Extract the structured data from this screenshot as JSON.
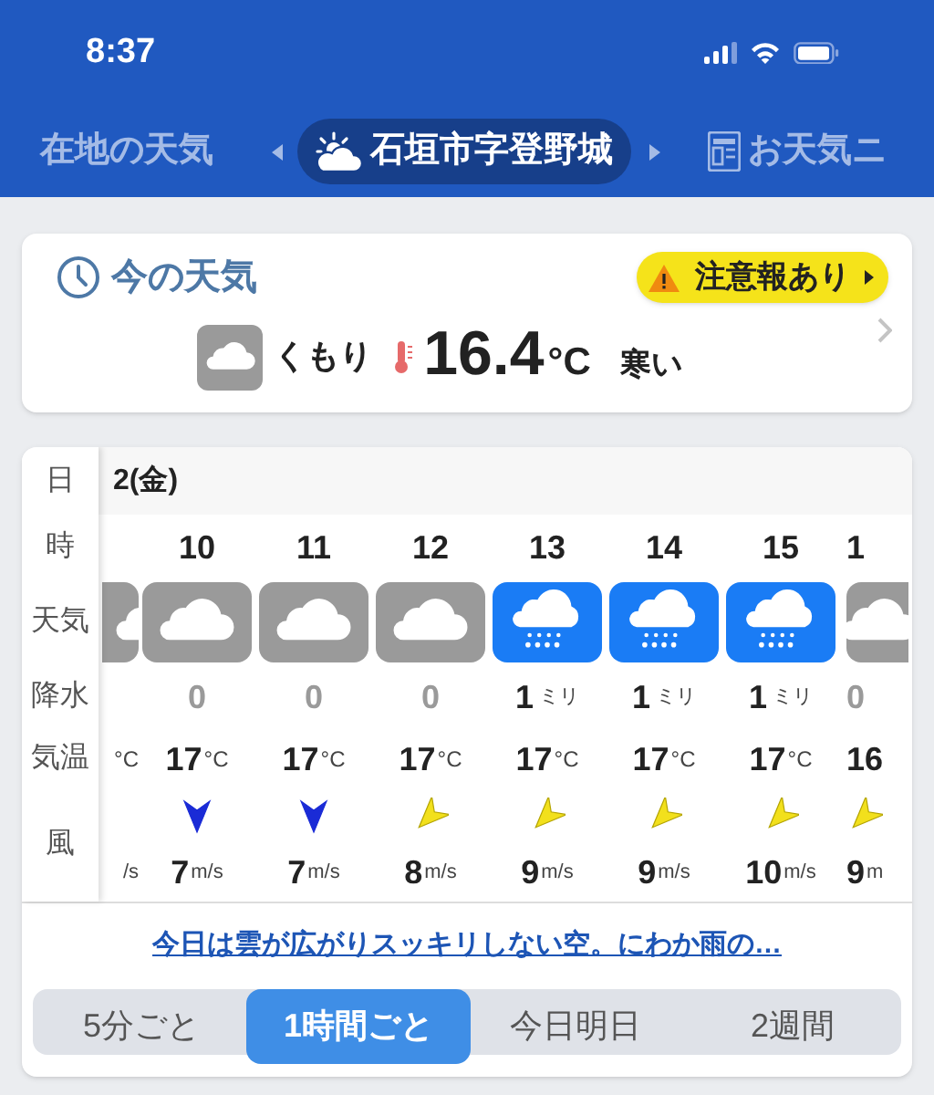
{
  "status_bar": {
    "time": "8:37"
  },
  "location_tabs": [
    {
      "label": "在地の天気",
      "selected": false,
      "kind": "text"
    },
    {
      "label": "石垣市字登野城",
      "selected": true,
      "kind": "location"
    },
    {
      "label": "お天気ニ",
      "selected": false,
      "kind": "news"
    }
  ],
  "current": {
    "title": "今の天気",
    "alert": "注意報あり",
    "icon": {
      "kind": "cloudy"
    },
    "condition": "くもり",
    "temperature": "16.4",
    "unit": "°C",
    "feel": "寒い"
  },
  "forecast": {
    "labels": [
      "日",
      "時",
      "天気",
      "降水",
      "気温",
      "風"
    ],
    "date": "2(金)",
    "hours": [
      {
        "kind": "partial_left",
        "icon": {
          "kind": "cloudy"
        },
        "temp_unit": "°C",
        "wind_unit": "/s"
      },
      {
        "kind": "full",
        "hour": "10",
        "icon": {
          "kind": "cloudy"
        },
        "precip": "0",
        "temp": "17",
        "temp_unit": "°C",
        "wind_arrow": {
          "kind": "north",
          "color": "#1a2bd6"
        },
        "wind": "7",
        "wind_unit": "m/s"
      },
      {
        "kind": "full",
        "hour": "11",
        "icon": {
          "kind": "cloudy"
        },
        "precip": "0",
        "temp": "17",
        "temp_unit": "°C",
        "wind_arrow": {
          "kind": "north",
          "color": "#1a2bd6"
        },
        "wind": "7",
        "wind_unit": "m/s"
      },
      {
        "kind": "full",
        "hour": "12",
        "icon": {
          "kind": "cloudy"
        },
        "precip": "0",
        "temp": "17",
        "temp_unit": "°C",
        "wind_arrow": {
          "kind": "northeast",
          "color": "#f2e01c"
        },
        "wind": "8",
        "wind_unit": "m/s"
      },
      {
        "kind": "full",
        "hour": "13",
        "icon": {
          "kind": "rain"
        },
        "precip": "1",
        "precip_unit": "ミリ",
        "temp": "17",
        "temp_unit": "°C",
        "wind_arrow": {
          "kind": "northeast",
          "color": "#f2e01c"
        },
        "wind": "9",
        "wind_unit": "m/s"
      },
      {
        "kind": "full",
        "hour": "14",
        "icon": {
          "kind": "rain"
        },
        "precip": "1",
        "precip_unit": "ミリ",
        "temp": "17",
        "temp_unit": "°C",
        "wind_arrow": {
          "kind": "northeast",
          "color": "#f2e01c"
        },
        "wind": "9",
        "wind_unit": "m/s"
      },
      {
        "kind": "full",
        "hour": "15",
        "icon": {
          "kind": "rain"
        },
        "precip": "1",
        "precip_unit": "ミリ",
        "temp": "17",
        "temp_unit": "°C",
        "wind_arrow": {
          "kind": "northeast",
          "color": "#f2e01c"
        },
        "wind": "10",
        "wind_unit": "m/s"
      },
      {
        "kind": "partial_right",
        "hour": "1",
        "icon": {
          "kind": "cloudy"
        },
        "precip": "0",
        "temp": "16",
        "wind_arrow": {
          "kind": "northeast",
          "color": "#f2e01c"
        },
        "wind": "9",
        "wind_unit": "m"
      }
    ]
  },
  "summary_link": "今日は雲が広がりスッキリしない空。にわか雨の…",
  "modes": [
    {
      "label": "5分ごと",
      "selected": false
    },
    {
      "label": "1時間ごと",
      "selected": true
    },
    {
      "label": "今日明日",
      "selected": false
    },
    {
      "label": "2週間",
      "selected": false
    }
  ]
}
